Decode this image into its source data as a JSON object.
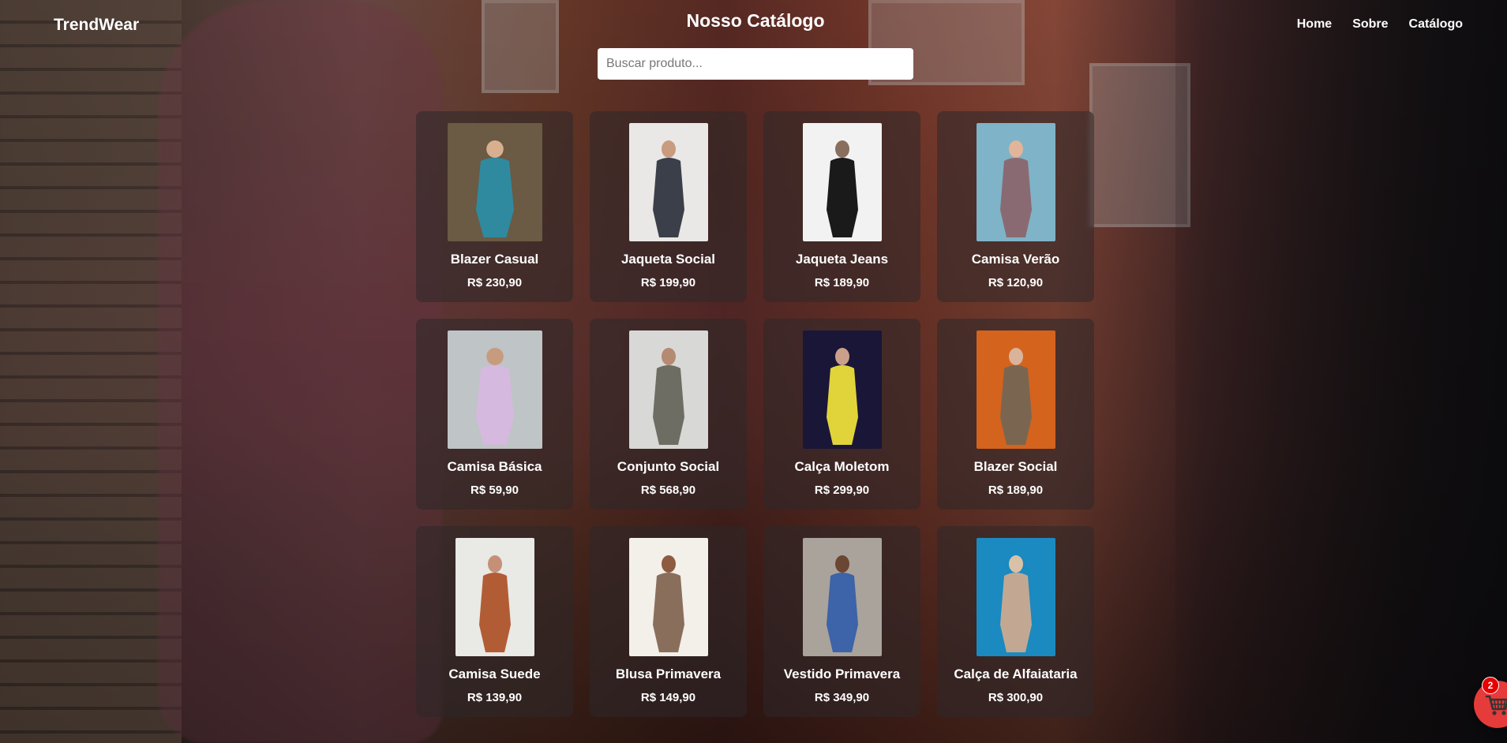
{
  "brand": "TrendWear",
  "page_title": "Nosso Catálogo",
  "nav": [
    {
      "label": "Home"
    },
    {
      "label": "Sobre"
    },
    {
      "label": "Catálogo"
    }
  ],
  "search": {
    "placeholder": "Buscar produto...",
    "value": ""
  },
  "products": [
    {
      "name": "Blazer Casual",
      "price": "R$ 230,90",
      "photo": {
        "bg": "#6b5a44",
        "accent": "#2f8aa0",
        "skin": "#d9b08f"
      }
    },
    {
      "name": "Jaqueta Social",
      "price": "R$ 199,90",
      "photo": {
        "bg": "#e9e8e6",
        "accent": "#3b3f4a",
        "skin": "#c99b7f"
      }
    },
    {
      "name": "Jaqueta Jeans",
      "price": "R$ 189,90",
      "photo": {
        "bg": "#f2f2f2",
        "accent": "#1a1a1a",
        "skin": "#8a6e5e"
      }
    },
    {
      "name": "Camisa Verão",
      "price": "R$ 120,90",
      "photo": {
        "bg": "#7fb3c7",
        "accent": "#8a6a72",
        "skin": "#e2b49a"
      }
    },
    {
      "name": "Camisa Básica",
      "price": "R$ 59,90",
      "photo": {
        "bg": "#bfc4c6",
        "accent": "#d6b9de",
        "skin": "#c79b7d"
      }
    },
    {
      "name": "Conjunto Social",
      "price": "R$ 568,90",
      "photo": {
        "bg": "#d8d8d6",
        "accent": "#6e6d63",
        "skin": "#b48a72"
      }
    },
    {
      "name": "Calça Moletom",
      "price": "R$ 299,90",
      "photo": {
        "bg": "#1a1638",
        "accent": "#e1d43a",
        "skin": "#caa08a"
      }
    },
    {
      "name": "Blazer Social",
      "price": "R$ 189,90",
      "photo": {
        "bg": "#d4631e",
        "accent": "#7a6650",
        "skin": "#d9b49a"
      }
    },
    {
      "name": "Camisa Suede",
      "price": "R$ 139,90",
      "photo": {
        "bg": "#e9e9e6",
        "accent": "#b25c35",
        "skin": "#c49178"
      }
    },
    {
      "name": "Blusa Primavera",
      "price": "R$ 149,90",
      "photo": {
        "bg": "#f3efe9",
        "accent": "#8a6e5c",
        "skin": "#8e5a40"
      }
    },
    {
      "name": "Vestido Primavera",
      "price": "R$ 349,90",
      "photo": {
        "bg": "#a9a39c",
        "accent": "#3d63a8",
        "skin": "#6a4633"
      }
    },
    {
      "name": "Calça de Alfaiataria",
      "price": "R$ 300,90",
      "photo": {
        "bg": "#1a8ac0",
        "accent": "#c2a892",
        "skin": "#d9c1a8"
      }
    }
  ],
  "cart": {
    "count": "2"
  }
}
